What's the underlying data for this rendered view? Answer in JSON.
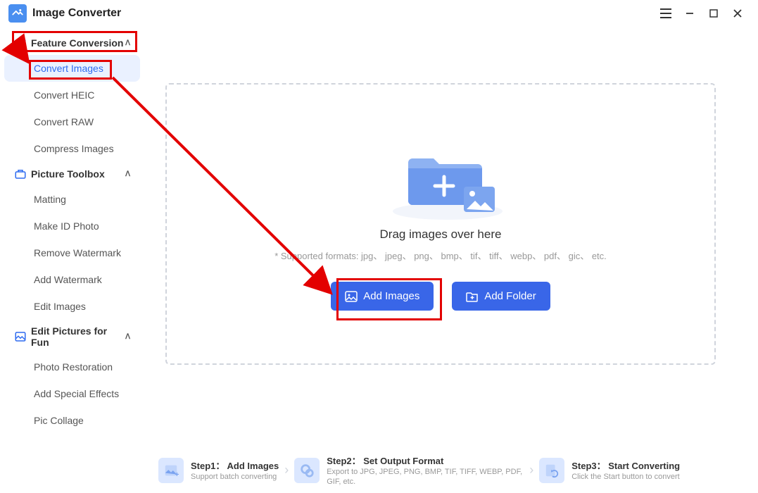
{
  "app": {
    "title": "Image Converter"
  },
  "window_controls": {
    "menu": "≡",
    "minimize": "—",
    "maximize": "☐",
    "close": "✕"
  },
  "sidebar": {
    "sections": [
      {
        "title": "Feature Conversion",
        "items": [
          {
            "label": "Convert Images",
            "active": true
          },
          {
            "label": "Convert HEIC"
          },
          {
            "label": "Convert RAW"
          },
          {
            "label": "Compress Images"
          }
        ]
      },
      {
        "title": "Picture Toolbox",
        "items": [
          {
            "label": "Matting"
          },
          {
            "label": "Make ID Photo"
          },
          {
            "label": "Remove Watermark"
          },
          {
            "label": "Add Watermark"
          },
          {
            "label": "Edit Images"
          }
        ]
      },
      {
        "title": "Edit Pictures for Fun",
        "items": [
          {
            "label": "Photo Restoration"
          },
          {
            "label": "Add Special Effects"
          },
          {
            "label": "Pic Collage"
          }
        ]
      }
    ]
  },
  "dropzone": {
    "drag_text": "Drag images over here",
    "formats_text": "* Supported formats: jpg、 jpeg、 png、 bmp、 tif、 tiff、 webp、 pdf、 gic、 etc.",
    "add_images_btn": "Add Images",
    "add_folder_btn": "Add Folder"
  },
  "steps": [
    {
      "title": "Step1： Add Images",
      "desc": "Support batch converting"
    },
    {
      "title": "Step2： Set Output Format",
      "desc": "Export to JPG, JPEG, PNG, BMP, TIF, TIFF, WEBP, PDF, GIF, etc."
    },
    {
      "title": "Step3： Start Converting",
      "desc": "Click the Start button to convert"
    }
  ]
}
